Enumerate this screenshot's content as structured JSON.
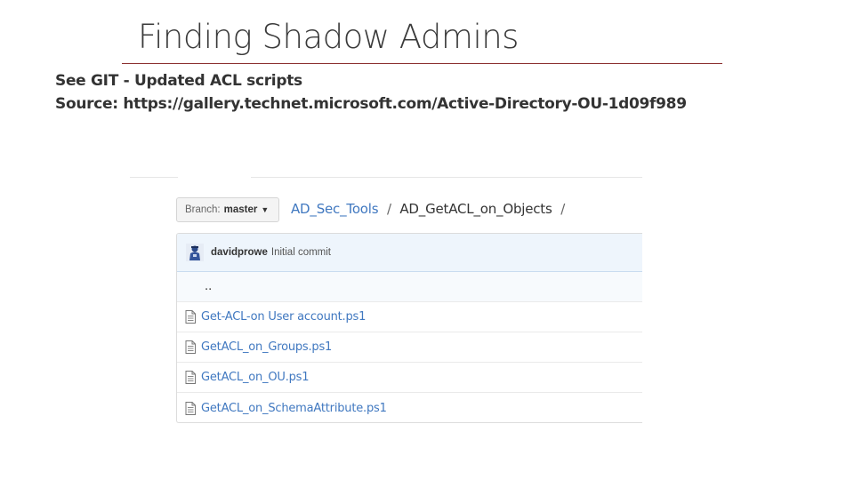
{
  "slide": {
    "title": "Finding Shadow Admins",
    "line1": "See GIT - Updated ACL scripts",
    "line2": "Source: https://gallery.technet.microsoft.com/Active-Directory-OU-1d09f989"
  },
  "repo": {
    "branch_label": "Branch:",
    "branch_value": "master",
    "breadcrumb": {
      "repo": "AD_Sec_Tools",
      "sep1": "/",
      "folder": "AD_GetACL_on_Objects",
      "sep2": "/"
    },
    "commit": {
      "author": "davidprowe",
      "message": "Initial commit"
    },
    "parent_dir": "..",
    "files": [
      {
        "name": "Get-ACL-on User account.ps1"
      },
      {
        "name": "GetACL_on_Groups.ps1"
      },
      {
        "name": "GetACL_on_OU.ps1"
      },
      {
        "name": "GetACL_on_SchemaAttribute.ps1"
      }
    ]
  },
  "colors": {
    "link": "#4078c0",
    "title_rule": "#8b2f2f",
    "commit_bg": "#eef5fc"
  },
  "icons": {
    "file": "file-text-icon",
    "caret": "caret-down-icon",
    "avatar": "user-avatar"
  }
}
